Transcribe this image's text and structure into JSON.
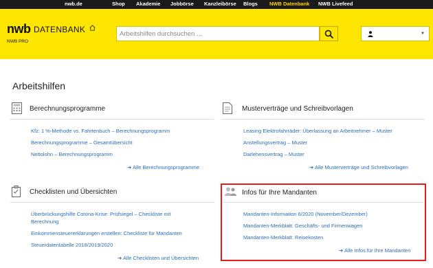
{
  "topnav": [
    "nwb.de",
    "Shop",
    "Akademie",
    "Jobbörse",
    "Kanzleibörse",
    "Blogs",
    "NWB Datenbank",
    "NWB Livefeed"
  ],
  "header": {
    "logo_main": "nwb",
    "logo_db": "DATENBANK",
    "logo_sub": "NWB PRO",
    "search_placeholder": "Arbeitshilfen durchsuchen ..."
  },
  "page": {
    "title": "Arbeitshilfen"
  },
  "cards": {
    "berechnung": {
      "title": "Berechnungsprogramme",
      "links": [
        "Kfz: 1 %-Methode vs. Fahrtenbuch – Berechnungsprogramm",
        "Berechnungsprogramme – Gesamtübersicht",
        "Nettolohn – Berechnungsprogramm"
      ],
      "more": "Alle Berechnungsprogramme"
    },
    "muster": {
      "title": "Musterverträge und Schreibvorlagen",
      "links": [
        "Leasing Elektrofahrräder: Überlassung an Arbeitnehmer – Muster",
        "Anstellungsvertrag – Muster",
        "Darlehensvertrag – Muster"
      ],
      "more": "Alle Musterverträge und Schreibvorlagen"
    },
    "checklisten": {
      "title": "Checklisten und Übersichten",
      "links": [
        "Überbrückungshilfe Corona-Krise: Prüfsiegel – Checkliste mit",
        "Berechnung",
        "Einkommensteuererklärungen erstellen: Checkliste für Mandanten",
        "Steuerdatentabelle 2018/2019/2020"
      ],
      "more": "Alle Checklisten und Übersichten"
    },
    "mandanten": {
      "title": "Infos für Ihre Mandanten",
      "links": [
        "Mandanten-Information 6/2020 (November/Dezember)",
        "Mandanten-Merkblatt: Geschäfts- und Firmenwagen",
        "Mandanten-Merkblatt: Reisekosten"
      ],
      "more": "Alle Infos für Ihre Mandanten"
    }
  },
  "colors": {
    "brand_yellow": "#ffe600",
    "link": "#2c6eb5",
    "highlight": "#e41c1c",
    "topbar": "#1a1a1a"
  },
  "icons": [
    "home-icon",
    "search-icon",
    "user-icon",
    "chevron-down-icon",
    "calculator-icon",
    "document-icon",
    "checklist-icon",
    "people-icon",
    "arrow-right-icon"
  ]
}
